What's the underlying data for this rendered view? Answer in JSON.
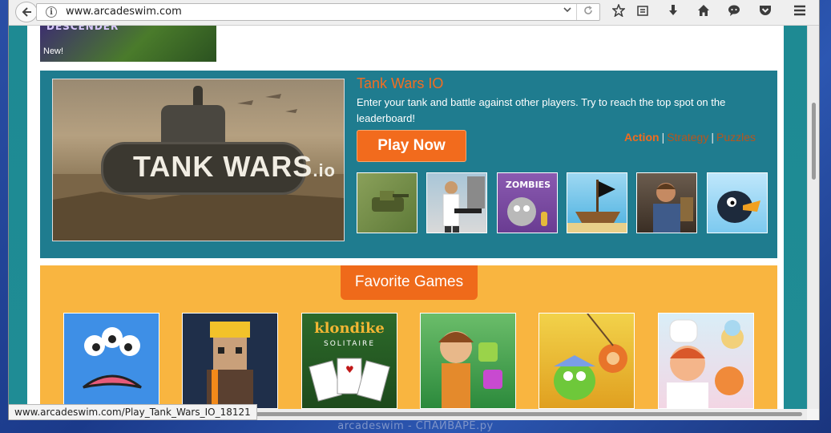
{
  "browser": {
    "url": "www.arcadeswim.com",
    "status_url": "www.arcadeswim.com/Play_Tank_Wars_IO_18121"
  },
  "icons": {
    "back": "back-arrow-icon",
    "info": "info-icon",
    "dropdown": "chevron-down-icon",
    "reload": "reload-icon",
    "bookmark": "star-icon",
    "reading_list": "clipboard-icon",
    "downloads": "download-icon",
    "home": "home-icon",
    "chat": "chat-icon",
    "pocket": "pocket-icon",
    "menu": "hamburger-menu-icon"
  },
  "previous_game": {
    "title": "DESCENDER",
    "badge": "New!"
  },
  "featured": {
    "hero_title": "TANK WARS",
    "hero_suffix": ".io",
    "title": "Tank Wars IO",
    "description": "Enter your tank and battle against other players. Try to reach the top spot on the leaderboard!",
    "play_label": "Play Now",
    "categories": [
      "Action",
      "Strategy",
      "Puzzles"
    ],
    "separator": "|",
    "thumbnails": [
      "tank",
      "shooter",
      "zombies",
      "pirates",
      "warrior",
      "bird"
    ]
  },
  "favorites": {
    "heading": "Favorite Games",
    "games": [
      "monster",
      "builder",
      "klondike",
      "jungle",
      "cut-the-rope",
      "cooking"
    ],
    "klondike_title": "klondike",
    "klondike_sub": "SOLITAIRE"
  },
  "footer": {
    "watermark": "arcadeswim - СПАЙВАРЕ.ру"
  },
  "colors": {
    "accent": "#f26b1d",
    "featured_bg": "#1f7c8f",
    "favorites_bg": "#f9b540",
    "site_bg": "#1f8c95"
  }
}
